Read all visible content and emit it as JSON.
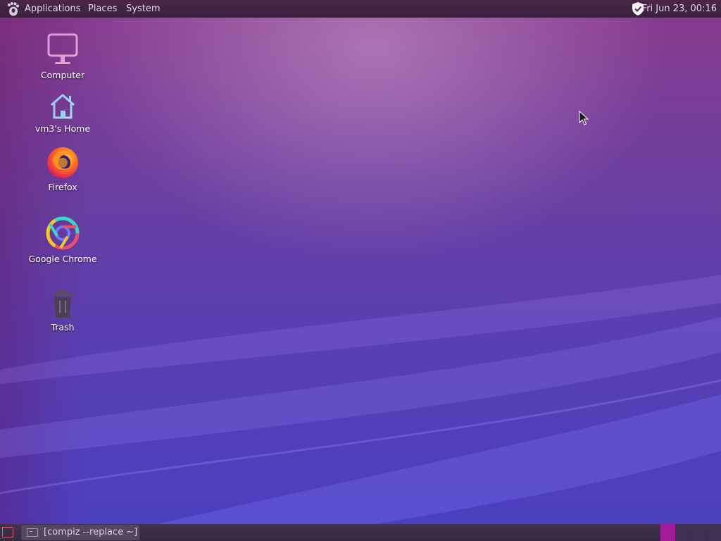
{
  "top_panel": {
    "menus": {
      "applications": "Applications",
      "places": "Places",
      "system": "System"
    },
    "clock": "Fri Jun 23, 00:16",
    "tray_icon": "shield-icon"
  },
  "desktop": {
    "icons": [
      {
        "label": "Computer",
        "icon": "monitor-icon"
      },
      {
        "label": "vm3's Home",
        "icon": "home-icon"
      },
      {
        "label": "Firefox",
        "icon": "firefox-icon"
      },
      {
        "label": "Google Chrome",
        "icon": "chrome-icon"
      },
      {
        "label": "Trash",
        "icon": "trash-icon"
      }
    ]
  },
  "bottom_panel": {
    "taskbar": [
      {
        "label": "[compiz --replace ~]",
        "icon": "terminal-icon"
      }
    ],
    "workspaces": [
      {
        "active": true,
        "color": "#a31a9a"
      },
      {
        "active": false,
        "color": "#3e3050"
      },
      {
        "active": false,
        "color": "#3e3050"
      },
      {
        "active": false,
        "color": "#3e3050"
      }
    ]
  }
}
